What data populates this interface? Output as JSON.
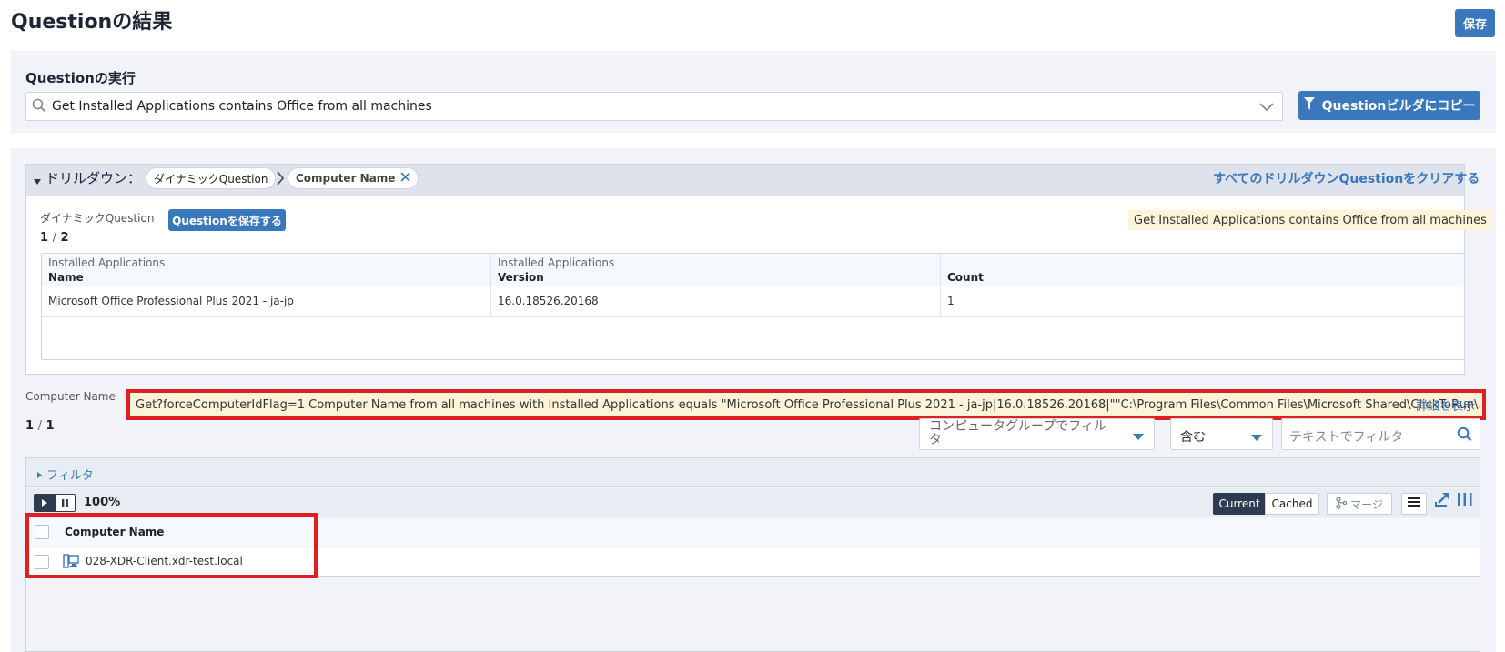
{
  "header": {
    "title": "Questionの結果",
    "save_label": "保存"
  },
  "run": {
    "label": "Questionの実行",
    "question_text": "Get Installed Applications contains Office from all machines",
    "copy_button": "Questionビルダにコピー"
  },
  "drilldown": {
    "label": "ドリルダウン：",
    "chips": [
      "ダイナミックQuestion",
      "Computer Name"
    ],
    "clear_link": "すべてのドリルダウンQuestionをクリアする",
    "dynamic_label": "ダイナミックQuestion",
    "save_question_button": "Questionを保存する",
    "page_current": "1",
    "page_sep": "/",
    "page_total": "2",
    "question_tag": "Get Installed Applications contains Office from all machines",
    "table": {
      "columns": [
        {
          "category": "Installed Applications",
          "name": "Name"
        },
        {
          "category": "Installed Applications",
          "name": "Version"
        },
        {
          "category": "",
          "name": "Count"
        }
      ],
      "rows": [
        [
          "Microsoft Office Professional Plus 2021 - ja-jp",
          "16.0.18526.20168",
          "1"
        ]
      ]
    }
  },
  "computer_name": {
    "label": "Computer Name",
    "query": "Get?forceComputerIdFlag=1 Computer Name from all machines with Installed Applications equals \"Microsoft Office Professional Plus 2021 - ja-jp|16.0.18526.20168|\"\"C:\\Program Files\\Common Files\\Microsoft Shared\\ClickToRun\\...",
    "show_details": "詳細を表示",
    "page_current": "1",
    "page_sep": "/",
    "page_total": "1",
    "group_filter_placeholder": "コンピュータグループでフィルタ",
    "operator": "含む",
    "text_filter_placeholder": "テキストでフィルタ"
  },
  "grid": {
    "filter_label": "フィルタ",
    "progress": "100%",
    "progress_value": 100,
    "current_label": "Current",
    "cached_label": "Cached",
    "merge_label": "マージ",
    "column_header": "Computer Name",
    "rows": [
      "028-XDR-Client.xdr-test.local"
    ]
  },
  "colors": {
    "accent": "#3a78bd",
    "highlight_border": "#e02020",
    "tag_bg": "#fdf3d8",
    "dark": "#2d3a4f"
  }
}
